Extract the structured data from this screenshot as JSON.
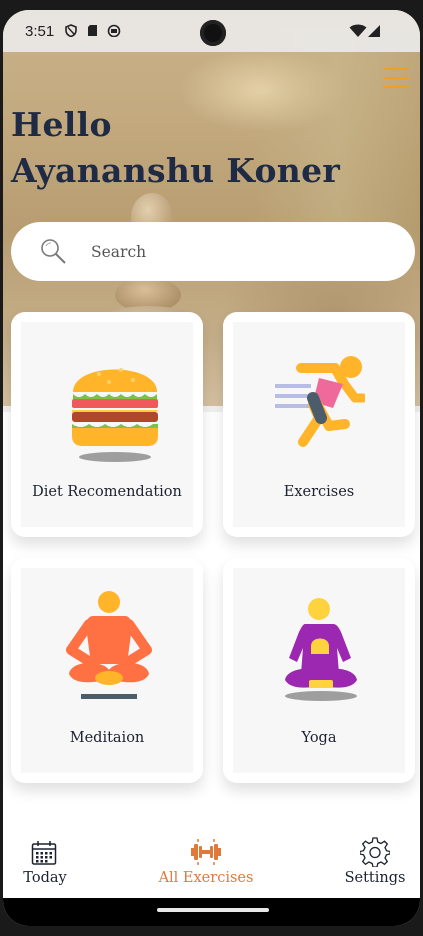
{
  "status_bar": {
    "time": "3:51"
  },
  "header": {
    "greeting_line1": "Hello",
    "greeting_line2": "Ayananshu Koner"
  },
  "search": {
    "placeholder": "Search"
  },
  "cards": [
    {
      "label": "Diet Recomendation",
      "icon": "burger-icon"
    },
    {
      "label": "Exercises",
      "icon": "running-person-icon"
    },
    {
      "label": "Meditaion",
      "icon": "meditation-person-icon"
    },
    {
      "label": "Yoga",
      "icon": "yoga-person-icon"
    }
  ],
  "bottom_nav": {
    "items": [
      {
        "label": "Today",
        "icon": "calendar-icon",
        "active": false
      },
      {
        "label": "All Exercises",
        "icon": "dumbbell-icon",
        "active": true
      },
      {
        "label": "Settings",
        "icon": "gear-icon",
        "active": false
      }
    ]
  },
  "colors": {
    "accent": "#f0a020",
    "active_nav": "#e07a3a",
    "title": "#1f2a44"
  }
}
